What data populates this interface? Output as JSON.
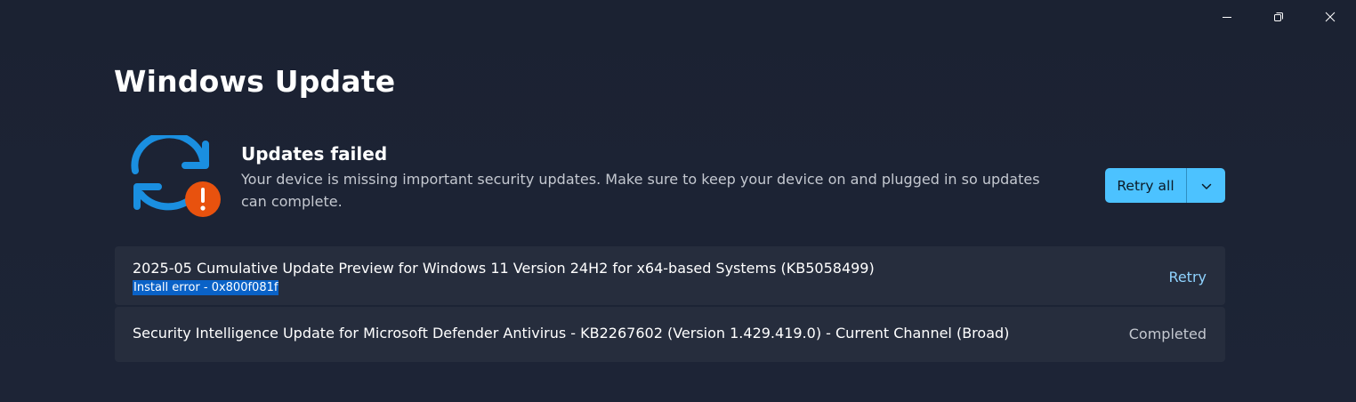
{
  "window": {
    "controls": {
      "minimize_icon": "minimize-icon",
      "restore_icon": "restore-icon",
      "close_icon": "close-icon"
    }
  },
  "page": {
    "title": "Windows Update"
  },
  "status": {
    "icon": "sync-error-icon",
    "title": "Updates failed",
    "description": "Your device is missing important security updates. Make sure to keep your device on and plugged in so updates can complete."
  },
  "actions": {
    "retry_all_label": "Retry all",
    "dropdown_icon": "chevron-down-icon"
  },
  "updates": [
    {
      "name": "2025-05 Cumulative Update Preview for Windows 11 Version 24H2 for x64-based Systems (KB5058499)",
      "error": "Install error - 0x800f081f",
      "action": "Retry"
    },
    {
      "name": "Security Intelligence Update for Microsoft Defender Antivirus - KB2267602 (Version 1.429.419.0) - Current Channel (Broad)",
      "status": "Completed"
    }
  ],
  "colors": {
    "background": "#1c2433",
    "card": "#262d3d",
    "accent": "#4cc2ff",
    "link": "#8fd3ff",
    "selection": "#0a62c7",
    "error_badge": "#e8520e",
    "sync_arrows": "#1a8fe0"
  }
}
